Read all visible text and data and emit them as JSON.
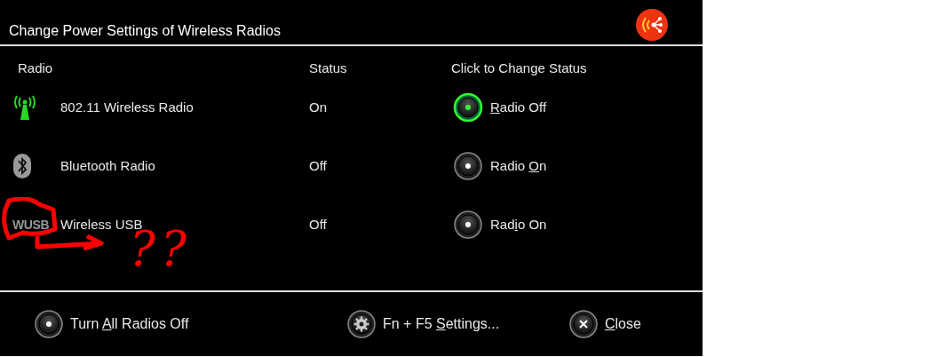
{
  "window": {
    "title": "Change Power Settings of Wireless Radios"
  },
  "columns": [
    "Radio",
    "Status",
    "Click to Change Status"
  ],
  "radios": [
    {
      "kind": "antenna",
      "name": "802.11 Wireless Radio",
      "status": "On",
      "on": true,
      "button": {
        "key": "R",
        "after": "adio Off"
      }
    },
    {
      "kind": "bluetooth",
      "name": "Bluetooth Radio",
      "status": "Off",
      "on": false,
      "button": {
        "before": "Radio ",
        "key": "O",
        "after": "n"
      }
    },
    {
      "kind": "wusb",
      "icon_text": "WUSB",
      "name": "Wireless USB",
      "status": "Off",
      "on": false,
      "button": {
        "before": "Rad",
        "key": "i",
        "after": "o On"
      }
    }
  ],
  "annotation": {
    "text": "??"
  },
  "footer": [
    {
      "kind": "radio",
      "before": "Turn ",
      "key": "A",
      "after": "ll Radios Off"
    },
    {
      "kind": "gear",
      "before": "Fn + F5 ",
      "key": "S",
      "after": "ettings..."
    },
    {
      "kind": "close",
      "key": "C",
      "after": "lose"
    }
  ]
}
